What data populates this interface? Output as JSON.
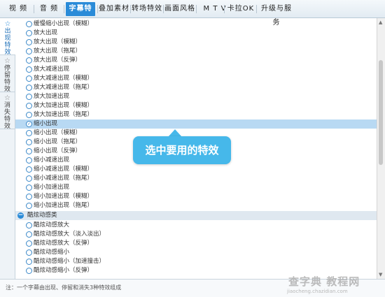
{
  "tabs": [
    {
      "label": "视 频"
    },
    {
      "label": "音 频"
    },
    {
      "label": "字幕特效"
    },
    {
      "label": "叠加素材"
    },
    {
      "label": "转场特效"
    },
    {
      "label": "画面风格"
    },
    {
      "label": "M T V"
    },
    {
      "label": "卡拉OK"
    },
    {
      "label": "升级与服务"
    }
  ],
  "sidebar": {
    "items": [
      {
        "label": "出现特效"
      },
      {
        "label": "停留特效"
      },
      {
        "label": "消失特效"
      }
    ]
  },
  "list": {
    "items": [
      {
        "label": "缓慢缩小出现（模糊）"
      },
      {
        "label": "放大出现"
      },
      {
        "label": "放大出现（模糊）"
      },
      {
        "label": "放大出现（拖尾）"
      },
      {
        "label": "放大出现（反弹）"
      },
      {
        "label": "放大减速出现"
      },
      {
        "label": "放大减速出现（模糊）"
      },
      {
        "label": "放大减速出现（拖尾）"
      },
      {
        "label": "放大加速出现"
      },
      {
        "label": "放大加速出现（模糊）"
      },
      {
        "label": "放大加速出现（拖尾）"
      },
      {
        "label": "缩小出现",
        "check": "✓"
      },
      {
        "label": "缩小出现（模糊）"
      },
      {
        "label": "缩小出现（拖尾）"
      },
      {
        "label": "缩小出现（反弹）"
      },
      {
        "label": "缩小减速出现"
      },
      {
        "label": "缩小减速出现（模糊）"
      },
      {
        "label": "缩小减速出现（拖尾）"
      },
      {
        "label": "缩小加速出现"
      },
      {
        "label": "缩小加速出现（模糊）"
      },
      {
        "label": "缩小加速出现（拖尾）"
      },
      {
        "label": "酷炫动感类",
        "group_symbol": "−"
      },
      {
        "label": "酷炫动感放大"
      },
      {
        "label": "酷炫动感放大（淡入淡出）"
      },
      {
        "label": "酷炫动感放大（反弹）"
      },
      {
        "label": "酷炫动感缩小"
      },
      {
        "label": "酷炫动感缩小（加速撞击）"
      },
      {
        "label": "酷炫动感缩小（反弹）"
      }
    ]
  },
  "tooltip": {
    "text": "选中要用的特效"
  },
  "footer": {
    "note": "注：一个字幕由出现、停留和消失3种特效组成"
  },
  "watermark": {
    "line1": "查字典 教程网",
    "line2": "jiaocheng.chazidian.com"
  },
  "colors": {
    "accent": "#2a8bd8",
    "selected_row": "#b8d9f3",
    "tooltip": "#46b8ea"
  }
}
